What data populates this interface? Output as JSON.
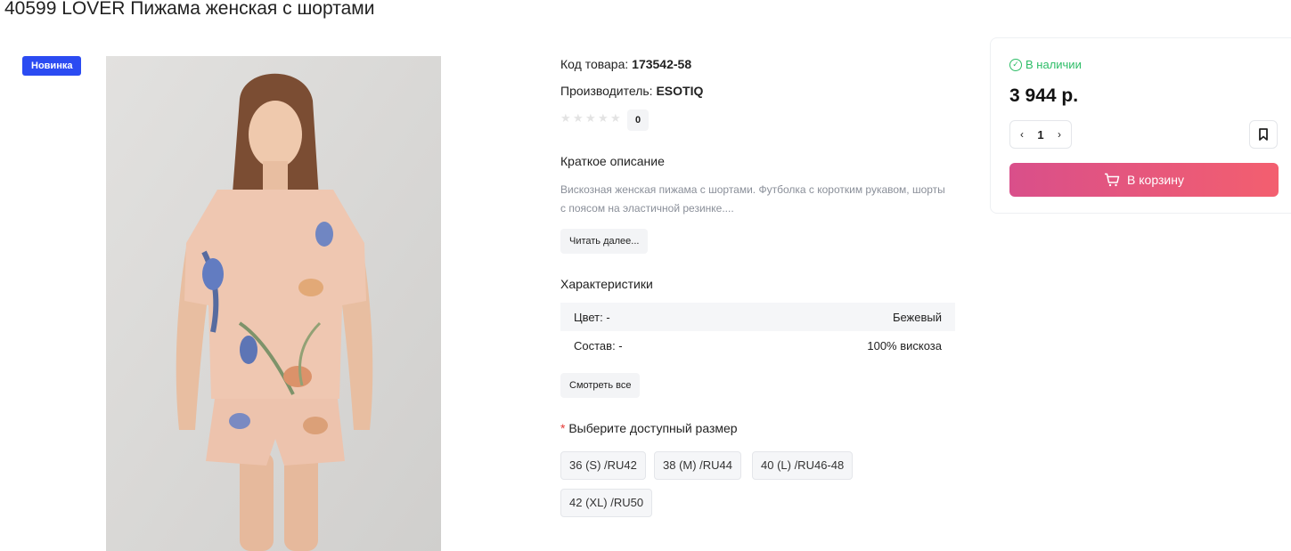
{
  "product": {
    "title": "40599 LOVER Пижама женская с шортами",
    "badge": "Новинка",
    "sku_label": "Код товара:",
    "sku_value": "173542-58",
    "brand_label": "Производитель:",
    "brand_value": "ESOTIQ",
    "rating_count": "0",
    "rating_value": 0,
    "rating_max": 5
  },
  "description": {
    "title": "Краткое описание",
    "text": "Вискозная женская пижама с шортами. Футболка с коротким рукавом, шорты с поясом на эластичной резинке....",
    "read_more": "Читать далее..."
  },
  "characteristics": {
    "title": "Характеристики",
    "rows": [
      {
        "name": "Цвет: -",
        "value": "Бежевый"
      },
      {
        "name": "Состав: -",
        "value": "100% вискоза"
      }
    ],
    "show_all": "Смотреть все"
  },
  "sizes": {
    "required_mark": "*",
    "title": "Выберите доступный размер",
    "options": [
      "36 (S) /RU42",
      "38 (M) /RU44",
      "40 (L) /RU46-48",
      "42 (XL) /RU50"
    ]
  },
  "buy": {
    "stock": "В наличии",
    "price": "3 944 р.",
    "quantity": "1",
    "cart_label": "В корзину"
  },
  "colors": {
    "badge": "#2b4bf2",
    "stock": "#2dbd67",
    "cart_start": "#d94f8a",
    "cart_end": "#f35f6f",
    "required": "#e53935"
  }
}
